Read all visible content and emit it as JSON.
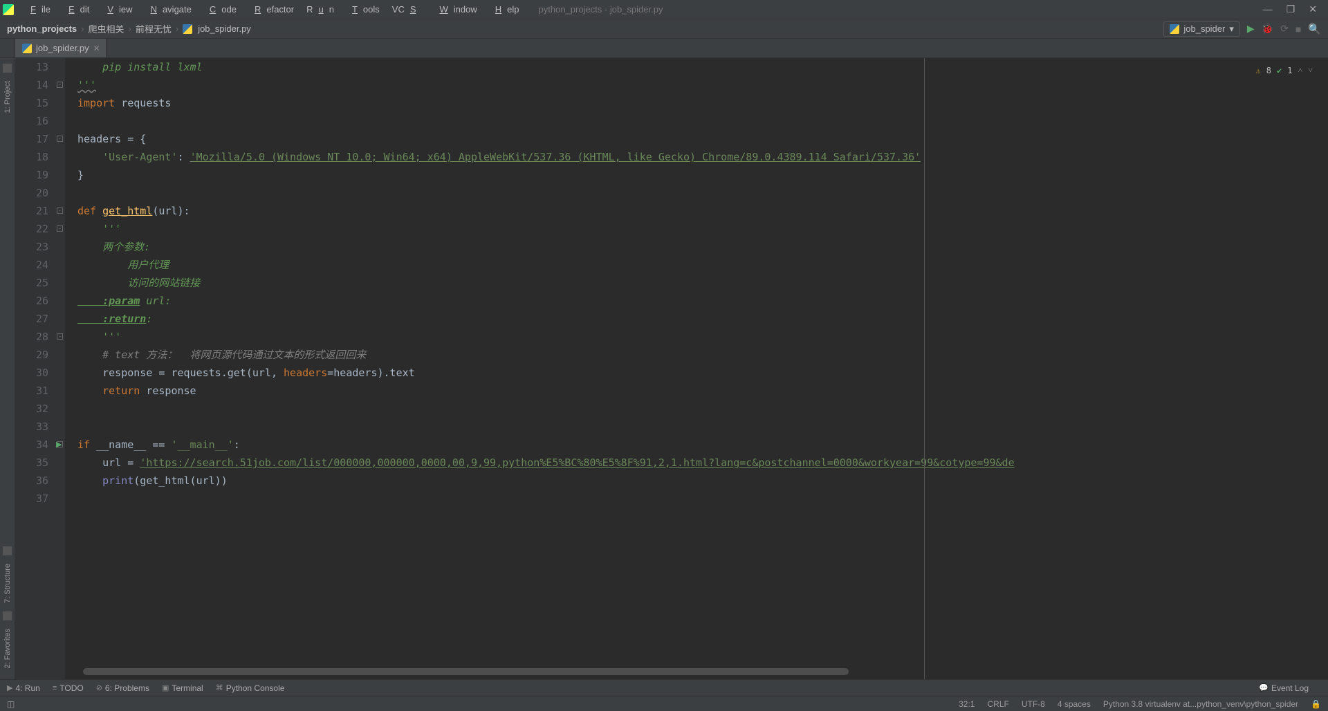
{
  "window_title": "python_projects - job_spider.py",
  "menubar": [
    "File",
    "Edit",
    "View",
    "Navigate",
    "Code",
    "Refactor",
    "Run",
    "Tools",
    "VCS",
    "Window",
    "Help"
  ],
  "breadcrumbs": {
    "project": "python_projects",
    "dir1": "爬虫相关",
    "dir2": "前程无忧",
    "file": "job_spider.py"
  },
  "run_config": "job_spider",
  "tab_file": "job_spider.py",
  "left_sidebar": {
    "project": "1: Project",
    "structure": "7: Structure",
    "favorites": "2: Favorites"
  },
  "gutter_start": 13,
  "inspections": {
    "warnings": "8",
    "typos": "1"
  },
  "code_lines": [
    {
      "t": "doc",
      "txt": "    pip install lxml"
    },
    {
      "t": "doc-end",
      "txt": "'''"
    },
    {
      "t": "import",
      "kw": "import",
      "rest": " requests"
    },
    {
      "t": "blank",
      "txt": ""
    },
    {
      "t": "plain",
      "txt": "headers = {"
    },
    {
      "t": "header-line",
      "key": "    'User-Agent'",
      "colon": ": ",
      "val": "'Mozilla/5.0 (Windows NT 10.0; Win64; x64) AppleWebKit/537.36 (KHTML, like Gecko) Chrome/89.0.4389.114 Safari/537.36'"
    },
    {
      "t": "plain",
      "txt": "}"
    },
    {
      "t": "blank",
      "txt": ""
    },
    {
      "t": "def",
      "kw": "def ",
      "fn": "get_html",
      "rest": "(url):"
    },
    {
      "t": "doc",
      "txt": "    '''"
    },
    {
      "t": "doc",
      "txt": "    两个参数:"
    },
    {
      "t": "doc",
      "txt": "        用户代理"
    },
    {
      "t": "doc",
      "txt": "        访问的网站链接"
    },
    {
      "t": "doctag",
      "tag": "    :param",
      "rest": " url:"
    },
    {
      "t": "doctag",
      "tag": "    :return",
      "rest": ":"
    },
    {
      "t": "doc",
      "txt": "    '''"
    },
    {
      "t": "comment",
      "txt": "    # text 方法：  将网页源代码通过文本的形式返回回来"
    },
    {
      "t": "resp",
      "pre": "    response = requests.get(url, ",
      "kw": "headers",
      "post": "=headers).text"
    },
    {
      "t": "return",
      "kw": "    return ",
      "rest": "response"
    },
    {
      "t": "blank",
      "txt": ""
    },
    {
      "t": "blank",
      "txt": ""
    },
    {
      "t": "ifmain",
      "kw": "if ",
      "rest1": "__name__ == ",
      "str": "'__main__'",
      "rest2": ":"
    },
    {
      "t": "url",
      "pre": "    url = ",
      "str": "'https://search.51job.com/list/000000,000000,0000,00,9,99,python%E5%BC%80%E5%8F%91,2,1.html?lang=c&postchannel=0000&workyear=99&cotype=99&de"
    },
    {
      "t": "print",
      "pre": "    ",
      "builtin": "print",
      "rest": "(get_html(url))"
    },
    {
      "t": "blank",
      "txt": ""
    }
  ],
  "bottom_tools": {
    "run": "4: Run",
    "todo": "TODO",
    "problems": "6: Problems",
    "terminal": "Terminal",
    "pyconsole": "Python Console",
    "eventlog": "Event Log"
  },
  "status": {
    "pos": "32:1",
    "lineend": "CRLF",
    "encoding": "UTF-8",
    "indent": "4 spaces",
    "interpreter": "Python 3.8 virtualenv at...python_venv\\python_spider"
  }
}
